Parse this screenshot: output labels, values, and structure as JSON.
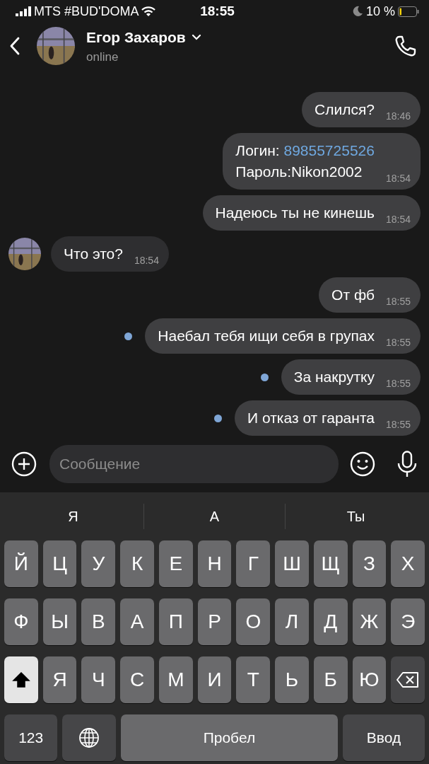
{
  "status_bar": {
    "carrier": "MTS #BUD'DOMA",
    "time": "18:55",
    "battery": "10 %"
  },
  "header": {
    "name": "Егор Захаров",
    "status": "online"
  },
  "messages": [
    {
      "outgoing": true,
      "lines": [
        {
          "text": "Слился?"
        }
      ],
      "time": "18:46",
      "unread": false
    },
    {
      "outgoing": true,
      "lines": [
        {
          "text": "Логин: ",
          "link": "89855725526"
        },
        {
          "text": "Пароль:Nikon2002"
        }
      ],
      "time": "18:54",
      "unread": false
    },
    {
      "outgoing": true,
      "lines": [
        {
          "text": "Надеюсь ты не кинешь"
        }
      ],
      "time": "18:54",
      "unread": false
    },
    {
      "outgoing": false,
      "lines": [
        {
          "text": "Что это?"
        }
      ],
      "time": "18:54",
      "unread": false
    },
    {
      "outgoing": true,
      "lines": [
        {
          "text": "От фб"
        }
      ],
      "time": "18:55",
      "unread": false
    },
    {
      "outgoing": true,
      "lines": [
        {
          "text": "Наебал тебя ищи себя в групах"
        }
      ],
      "time": "18:55",
      "unread": true
    },
    {
      "outgoing": true,
      "lines": [
        {
          "text": "За накрутку"
        }
      ],
      "time": "18:55",
      "unread": true
    },
    {
      "outgoing": true,
      "lines": [
        {
          "text": "И отказ от гаранта"
        }
      ],
      "time": "18:55",
      "unread": true
    }
  ],
  "composer": {
    "placeholder": "Сообщение"
  },
  "keyboard": {
    "suggestions": [
      "Я",
      "А",
      "Ты"
    ],
    "rows": [
      [
        {
          "kind": "char",
          "label": "Й"
        },
        {
          "kind": "char",
          "label": "Ц"
        },
        {
          "kind": "char",
          "label": "У"
        },
        {
          "kind": "char",
          "label": "К"
        },
        {
          "kind": "char",
          "label": "Е"
        },
        {
          "kind": "char",
          "label": "Н"
        },
        {
          "kind": "char",
          "label": "Г"
        },
        {
          "kind": "char",
          "label": "Ш"
        },
        {
          "kind": "char",
          "label": "Щ"
        },
        {
          "kind": "char",
          "label": "З"
        },
        {
          "kind": "char",
          "label": "Х"
        }
      ],
      [
        {
          "kind": "char",
          "label": "Ф"
        },
        {
          "kind": "char",
          "label": "Ы"
        },
        {
          "kind": "char",
          "label": "В"
        },
        {
          "kind": "char",
          "label": "А"
        },
        {
          "kind": "char",
          "label": "П"
        },
        {
          "kind": "char",
          "label": "Р"
        },
        {
          "kind": "char",
          "label": "О"
        },
        {
          "kind": "char",
          "label": "Л"
        },
        {
          "kind": "char",
          "label": "Д"
        },
        {
          "kind": "char",
          "label": "Ж"
        },
        {
          "kind": "char",
          "label": "Э"
        }
      ],
      [
        {
          "kind": "shift",
          "on": true
        },
        {
          "kind": "char",
          "label": "Я"
        },
        {
          "kind": "char",
          "label": "Ч"
        },
        {
          "kind": "char",
          "label": "С"
        },
        {
          "kind": "char",
          "label": "М"
        },
        {
          "kind": "char",
          "label": "И"
        },
        {
          "kind": "char",
          "label": "Т"
        },
        {
          "kind": "char",
          "label": "Ь"
        },
        {
          "kind": "char",
          "label": "Б"
        },
        {
          "kind": "char",
          "label": "Ю"
        },
        {
          "kind": "backspace"
        }
      ]
    ],
    "bottom_bar": [
      {
        "kind": "mode",
        "label": "123"
      },
      {
        "kind": "globe"
      },
      {
        "kind": "space",
        "label": "Пробел"
      },
      {
        "kind": "enter",
        "label": "Ввод"
      }
    ]
  }
}
